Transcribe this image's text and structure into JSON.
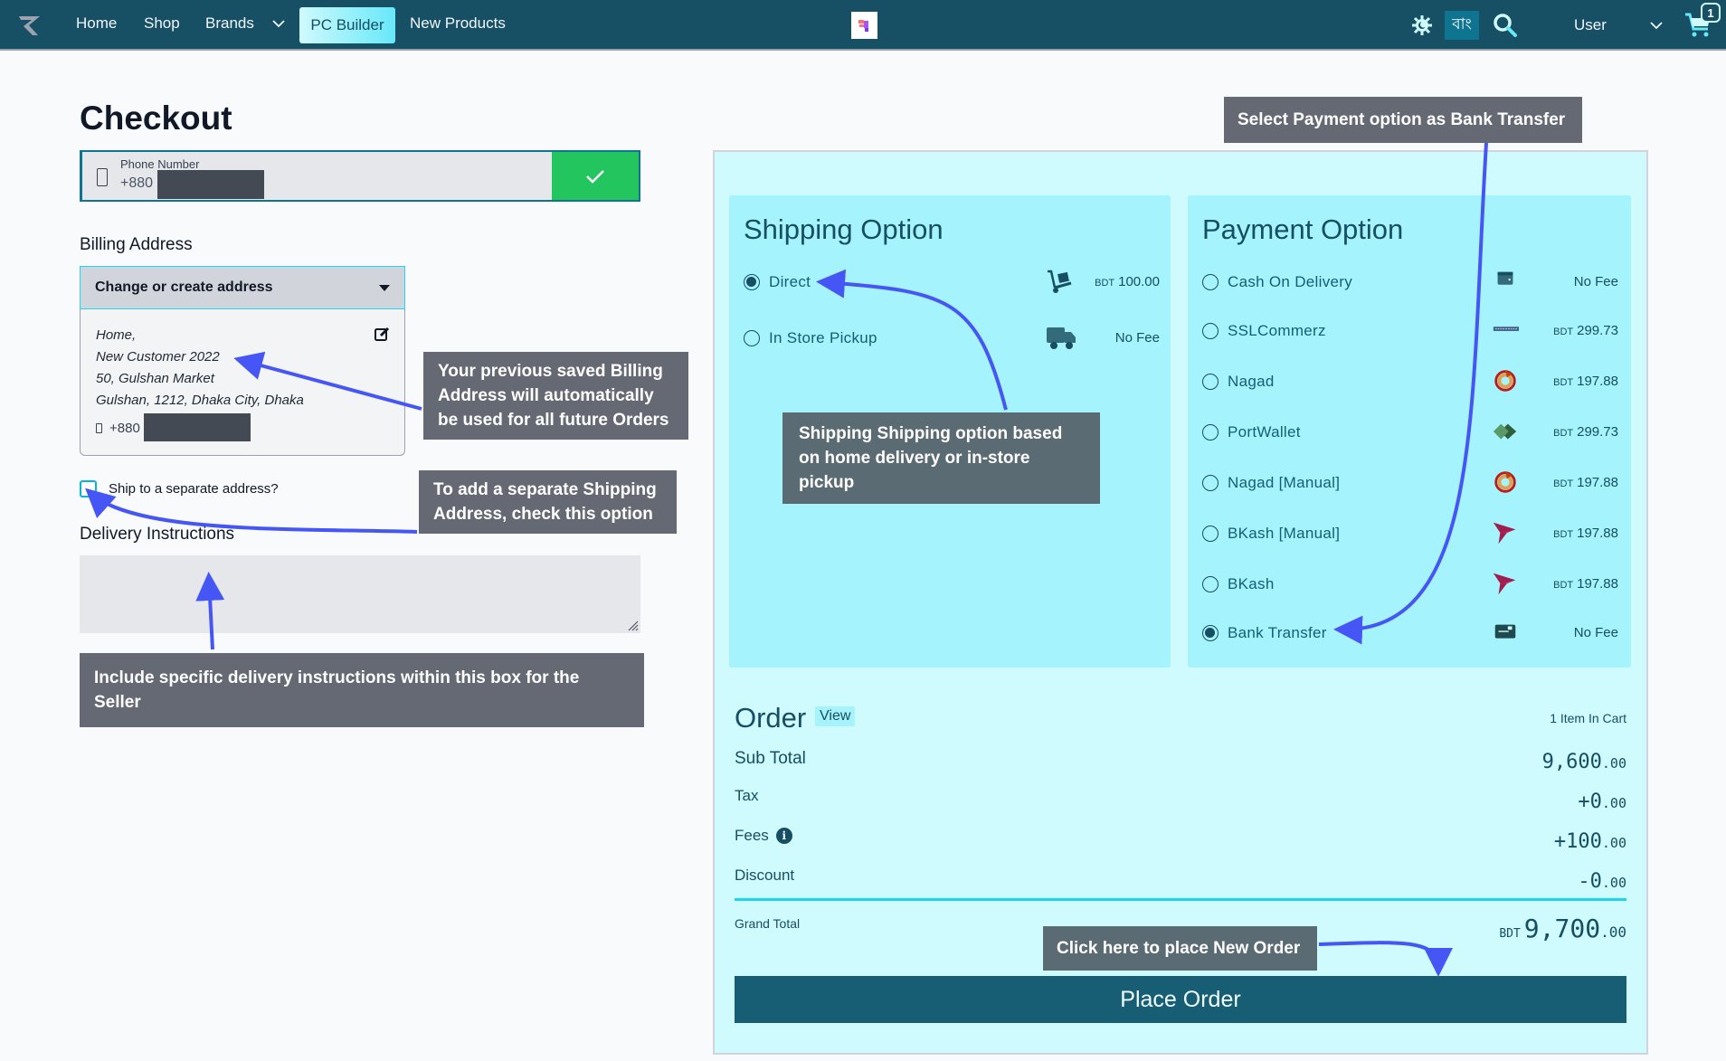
{
  "nav": {
    "links": [
      "Home",
      "Shop",
      "Brands",
      "PC Builder",
      "New Products"
    ],
    "active": "PC Builder",
    "lang_toggle": "বাং",
    "user_label": "User",
    "cart_count": "1"
  },
  "page": {
    "title": "Checkout"
  },
  "phone": {
    "label": "Phone Number",
    "prefix": "+880"
  },
  "billing": {
    "label": "Billing Address",
    "dropdown_label": "Change or create address",
    "address_lines": [
      "Home,",
      "New Customer 2022",
      "50, Gulshan Market",
      "Gulshan, 1212, Dhaka City, Dhaka"
    ],
    "phone_prefix": "+880"
  },
  "ship_separate": {
    "label": "Ship to a separate address?",
    "checked": false
  },
  "delivery": {
    "label": "Delivery Instructions",
    "value": ""
  },
  "shipping": {
    "title": "Shipping Option",
    "options": [
      {
        "label": "Direct",
        "icon": "hand-truck-icon",
        "fee_currency": "BDT",
        "fee": "100.00",
        "selected": true
      },
      {
        "label": "In Store Pickup",
        "icon": "truck-icon",
        "fee_currency": "",
        "fee": "No Fee",
        "selected": false
      }
    ]
  },
  "payment": {
    "title": "Payment Option",
    "options": [
      {
        "label": "Cash On Delivery",
        "icon": "wallet-icon",
        "fee_currency": "",
        "fee": "No Fee",
        "selected": false
      },
      {
        "label": "SSLCommerz",
        "icon": "sslcommerz-icon",
        "fee_currency": "BDT",
        "fee": "299.73",
        "selected": false
      },
      {
        "label": "Nagad",
        "icon": "nagad-icon",
        "fee_currency": "BDT",
        "fee": "197.88",
        "selected": false
      },
      {
        "label": "PortWallet",
        "icon": "portwallet-icon",
        "fee_currency": "BDT",
        "fee": "299.73",
        "selected": false
      },
      {
        "label": "Nagad [Manual]",
        "icon": "nagad-icon",
        "fee_currency": "BDT",
        "fee": "197.88",
        "selected": false
      },
      {
        "label": "BKash [Manual]",
        "icon": "bkash-icon",
        "fee_currency": "BDT",
        "fee": "197.88",
        "selected": false
      },
      {
        "label": "BKash",
        "icon": "bkash-icon",
        "fee_currency": "BDT",
        "fee": "197.88",
        "selected": false
      },
      {
        "label": "Bank Transfer",
        "icon": "bank-card-icon",
        "fee_currency": "",
        "fee": "No Fee",
        "selected": true
      }
    ]
  },
  "order": {
    "title": "Order",
    "view_label": "View",
    "item_count": "1 Item In Cart",
    "rows": [
      {
        "label": "Sub Total",
        "sign": "",
        "int": "9,600",
        "dec": ".00"
      },
      {
        "label": "Tax",
        "sign": "+",
        "int": "0",
        "dec": ".00"
      },
      {
        "label": "Fees",
        "sign": "+",
        "int": "100",
        "dec": ".00"
      },
      {
        "label": "Discount",
        "sign": "-",
        "int": "0",
        "dec": ".00"
      }
    ],
    "grand_total_label": "Grand Total",
    "grand_total_currency": "BDT",
    "grand_total_int": "9,700",
    "grand_total_dec": ".00",
    "place_order_label": "Place Order"
  },
  "callouts": {
    "billing": "Your previous saved Billing Address will automatically be used for all future Orders",
    "separate": "To add a separate Shipping Address, check this option",
    "delivery": "Include specific delivery instructions within this box for the Seller",
    "shipping": "Shipping Shipping option based on home delivery or in-store pickup",
    "payment": "Select Payment option as Bank Transfer",
    "place": "Click here to place New Order"
  },
  "colors": {
    "nav_bg": "#175064",
    "accent": "#22d3ee",
    "success": "#22c55e",
    "panel": "#a5f3fc",
    "arrow": "#4656f5"
  }
}
